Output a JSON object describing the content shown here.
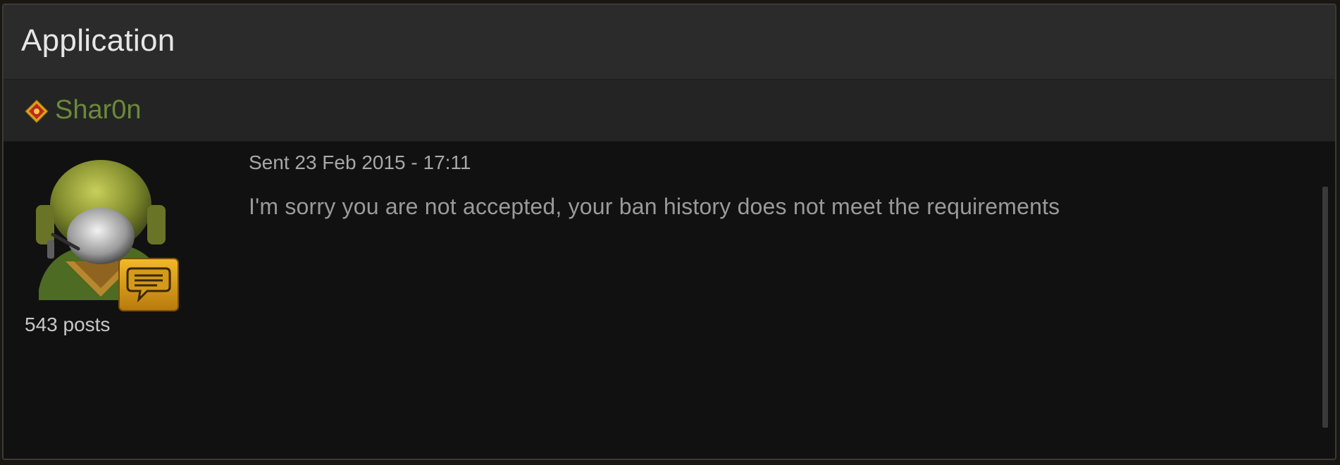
{
  "window": {
    "title": "Application"
  },
  "user": {
    "name": "Shar0n",
    "name_color": "#6b8a3a",
    "rank_icon": "rank-diamond-icon",
    "avatar_icon": "soldier-chat-avatar-icon",
    "post_count": "543 posts"
  },
  "message": {
    "sent": "Sent 23 Feb 2015 - 17:11",
    "body": "I'm sorry you are not accepted, your ban history does not meet the requirements"
  }
}
